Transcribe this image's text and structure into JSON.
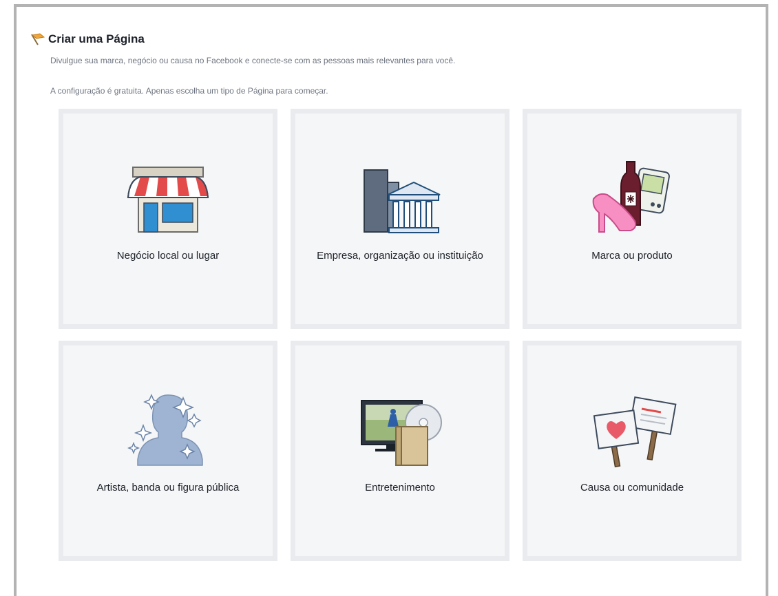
{
  "header": {
    "title": "Criar uma Página",
    "description": "Divulgue sua marca, negócio ou causa no Facebook e conecte-se com as pessoas mais relevantes para você.",
    "instruction": "A configuração é gratuita. Apenas escolha um tipo de Página para começar."
  },
  "categories": [
    {
      "label": "Negócio local ou lugar",
      "icon": "storefront-icon"
    },
    {
      "label": "Empresa, organização ou instituição",
      "icon": "buildings-icon"
    },
    {
      "label": "Marca ou produto",
      "icon": "products-icon"
    },
    {
      "label": "Artista, banda ou figura pública",
      "icon": "public-figure-icon"
    },
    {
      "label": "Entretenimento",
      "icon": "entertainment-icon"
    },
    {
      "label": "Causa ou comunidade",
      "icon": "signs-icon"
    }
  ]
}
